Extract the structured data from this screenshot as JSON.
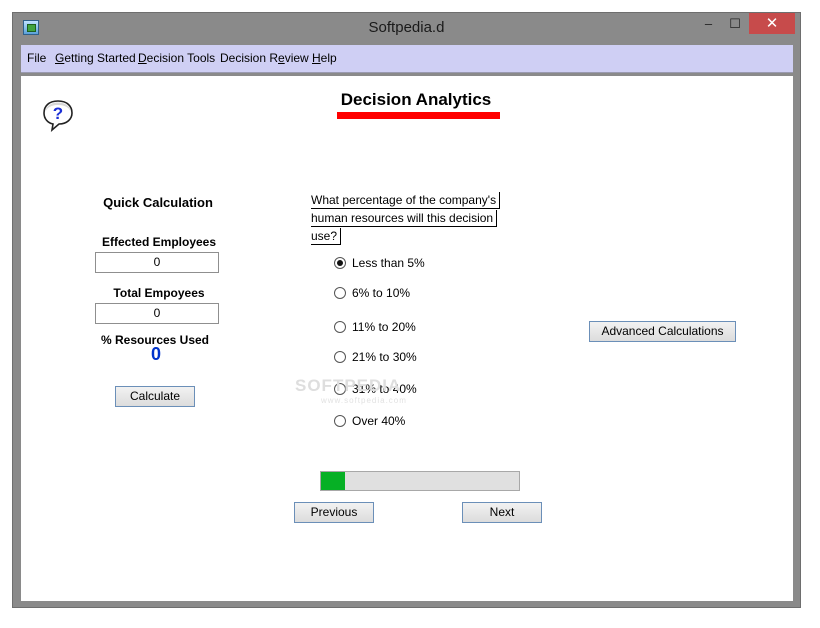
{
  "window": {
    "title": "Softpedia.d",
    "minimize_glyph": "–",
    "maximize_glyph": "☐",
    "close_glyph": "✕"
  },
  "menu": [
    {
      "label": "File"
    },
    {
      "label": "Getting Started"
    },
    {
      "label": "Decision Tools"
    },
    {
      "label": "Decision Review"
    },
    {
      "label": "Help"
    }
  ],
  "page": {
    "title": "Decision Analytics",
    "title_underline_color": "#ff0000",
    "help_icon": "question-mark-speech-bubble"
  },
  "quick_calc": {
    "heading": "Quick Calculation",
    "effected_label": "Effected Employees",
    "effected_value": "0",
    "total_label": "Total Empoyees",
    "total_value": "0",
    "resources_label": "% Resources Used",
    "resources_value": "0",
    "calculate_label": "Calculate"
  },
  "question": {
    "lines": [
      "What percentage of the company's",
      "human resources will this decision",
      "use?"
    ],
    "options": [
      {
        "label": "Less than 5%",
        "selected": true
      },
      {
        "label": "6% to 10%",
        "selected": false
      },
      {
        "label": "11% to 20%",
        "selected": false
      },
      {
        "label": "21% to 30%",
        "selected": false
      },
      {
        "label": "31% to 40%",
        "selected": false
      },
      {
        "label": "Over 40%",
        "selected": false
      }
    ]
  },
  "buttons": {
    "advanced": "Advanced Calculations",
    "previous": "Previous",
    "next": "Next"
  },
  "progress": {
    "fraction": 0.12,
    "color": "#06b025"
  },
  "watermark": {
    "text": "SOFTPEDIA",
    "sub": "www.softpedia.com"
  }
}
